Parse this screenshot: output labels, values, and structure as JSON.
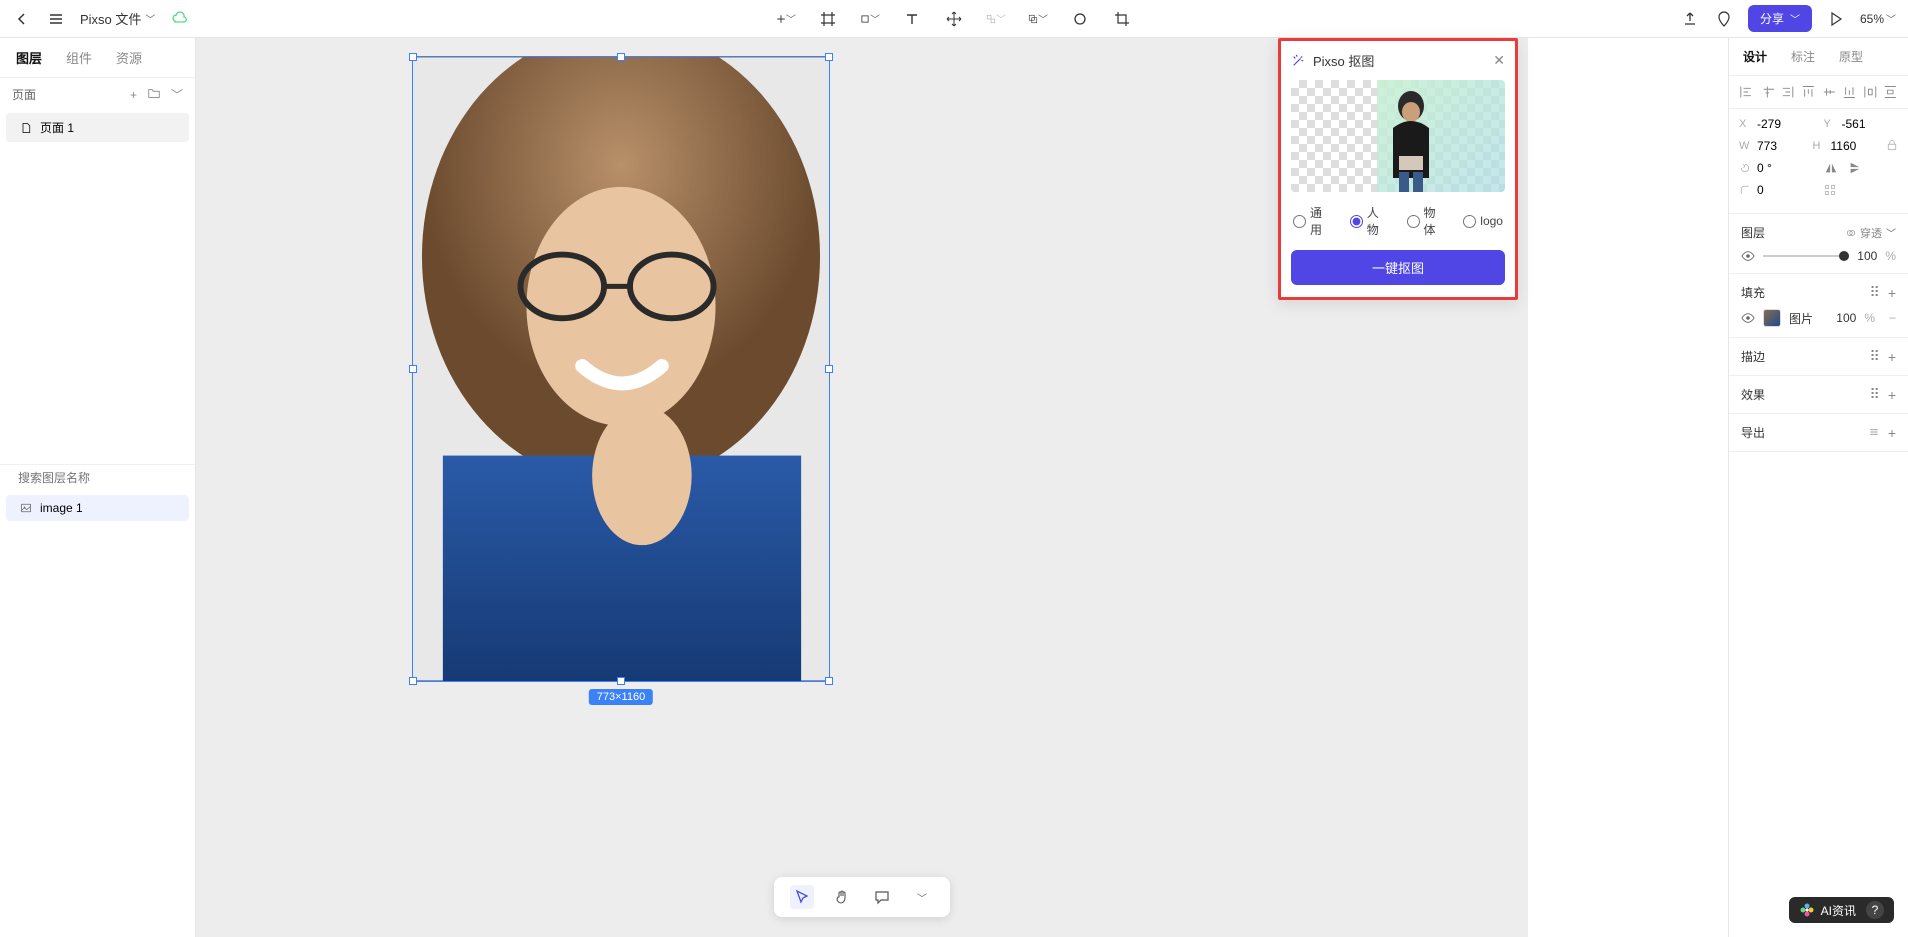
{
  "topbar": {
    "file_title": "Pixso 文件",
    "share_label": "分享",
    "zoom": "65%"
  },
  "left_panel": {
    "tabs": [
      "图层",
      "组件",
      "资源"
    ],
    "active_tab": 0,
    "pages_label": "页面",
    "pages": [
      {
        "name": "页面 1"
      }
    ],
    "search_placeholder": "搜索图层名称",
    "layers": [
      {
        "name": "image 1"
      }
    ]
  },
  "canvas": {
    "size_badge": "773×1160"
  },
  "popup": {
    "title": "Pixso 抠图",
    "options": {
      "general": "通用",
      "person": "人物",
      "object": "物体",
      "logo": "logo"
    },
    "selected": "person",
    "button_label": "一键抠图"
  },
  "right_panel": {
    "tabs": [
      "设计",
      "标注",
      "原型"
    ],
    "active_tab": 0,
    "x": "-279",
    "y": "-561",
    "w": "773",
    "h": "1160",
    "rotation": "0 °",
    "radius": "0",
    "sections": {
      "layer": {
        "title": "图层",
        "passthrough": "穿透",
        "opacity": "100",
        "opacity_unit": "%"
      },
      "fill": {
        "title": "填充",
        "type_label": "图片",
        "opacity": "100",
        "opacity_unit": "%"
      },
      "stroke": {
        "title": "描边"
      },
      "effect": {
        "title": "效果"
      },
      "export": {
        "title": "导出"
      }
    }
  },
  "watermark": {
    "label": "AI资讯"
  },
  "labels": {
    "x": "X",
    "y": "Y",
    "w": "W",
    "h": "H"
  }
}
